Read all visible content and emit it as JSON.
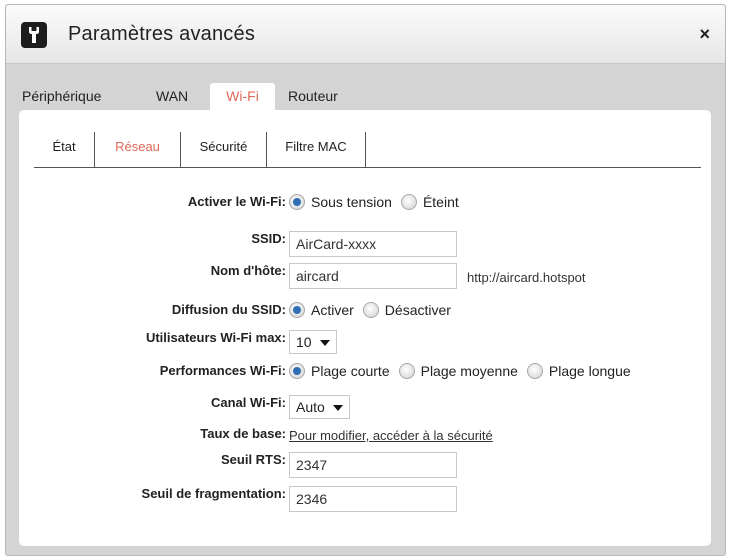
{
  "window": {
    "title": "Paramètres avancés",
    "close_label": "×"
  },
  "main_tabs": [
    {
      "label": "Périphérique",
      "active": false
    },
    {
      "label": "WAN",
      "active": false
    },
    {
      "label": "Wi-Fi",
      "active": true
    },
    {
      "label": "Routeur",
      "active": false
    }
  ],
  "sub_tabs": [
    {
      "label": "État",
      "active": false
    },
    {
      "label": "Réseau",
      "active": true
    },
    {
      "label": "Sécurité",
      "active": false
    },
    {
      "label": "Filtre MAC",
      "active": false
    }
  ],
  "form": {
    "wifi_enable": {
      "label": "Activer le Wi-Fi:",
      "options": [
        {
          "label": "Sous tension",
          "selected": true
        },
        {
          "label": "Éteint",
          "selected": false
        }
      ]
    },
    "ssid": {
      "label": "SSID:",
      "value": "AirCard-xxxx"
    },
    "hostname": {
      "label": "Nom d'hôte:",
      "value": "aircard",
      "hint": "http://aircard.hotspot"
    },
    "ssid_broadcast": {
      "label": "Diffusion du SSID:",
      "options": [
        {
          "label": "Activer",
          "selected": true
        },
        {
          "label": "Désactiver",
          "selected": false
        }
      ]
    },
    "max_users": {
      "label": "Utilisateurs Wi-Fi max:",
      "value": "10"
    },
    "performance": {
      "label": "Performances Wi-Fi:",
      "options": [
        {
          "label": "Plage courte",
          "selected": true
        },
        {
          "label": "Plage moyenne",
          "selected": false
        },
        {
          "label": "Plage longue",
          "selected": false
        }
      ]
    },
    "channel": {
      "label": "Canal Wi-Fi:",
      "value": "Auto"
    },
    "base_rate": {
      "label": "Taux de base:",
      "link": "Pour modifier, accéder à la sécurité"
    },
    "rts": {
      "label": "Seuil RTS:",
      "value": "2347"
    },
    "fragmentation": {
      "label": "Seuil de fragmentation:",
      "value": "2346"
    }
  },
  "colors": {
    "active_tab": "#e0695a",
    "radio_selected": "#2f6db5",
    "frame": "#d4d4d4"
  },
  "icons": {
    "app": "wrench-icon",
    "close": "close-icon"
  }
}
